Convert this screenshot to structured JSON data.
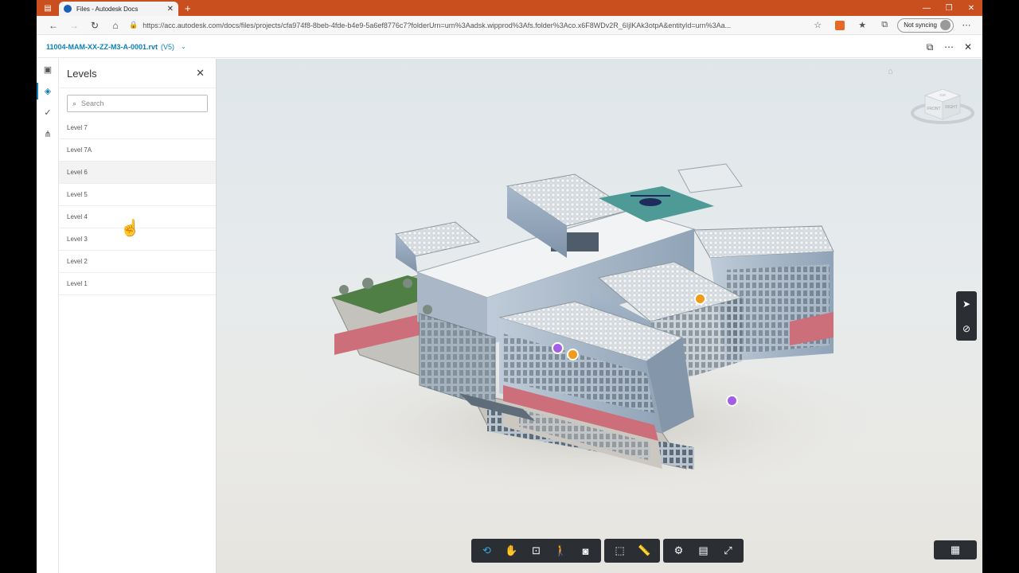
{
  "browser": {
    "tab_title": "Files - Autodesk Docs",
    "tab_close": "✕",
    "new_tab": "+",
    "url": "https://acc.autodesk.com/docs/files/projects/cfa974f8-8beb-4fde-b4e9-5a6ef8776c7?folderUrn=urn%3Aadsk.wipprod%3Afs.folder%3Aco.x6F8WDv2R_6IjlKAk3otpA&entityId=urn%3Aa...",
    "sync_label": "Not syncing",
    "icons": {
      "back": "←",
      "forward": "→",
      "refresh": "↻",
      "home": "⌂",
      "lock": "🔒",
      "star": "☆",
      "favorites": "★",
      "collections": "⧉",
      "more": "⋯",
      "minimize": "—",
      "restore": "❐",
      "close": "✕"
    }
  },
  "app": {
    "file_name": "11004-MAM-XX-ZZ-M3-A-0001.rvt",
    "file_version": "(V5)",
    "file_chevron": "⌄",
    "header_icons": {
      "compare": "⧉",
      "more": "⋯",
      "close": "✕"
    }
  },
  "rail": [
    {
      "name": "rail-sheets-button",
      "icon": "▣",
      "active": false
    },
    {
      "name": "rail-levels-button",
      "icon": "◈",
      "active": true
    },
    {
      "name": "rail-issues-button",
      "icon": "✓",
      "active": false
    },
    {
      "name": "rail-model-tree-button",
      "icon": "⋔",
      "active": false
    }
  ],
  "levels_panel": {
    "title": "Levels",
    "close": "✕",
    "search_placeholder": "Search",
    "search_icon": "⌕",
    "levels": [
      "Level 7",
      "Level 7A",
      "Level 6",
      "Level 5",
      "Level 4",
      "Level 3",
      "Level 2",
      "Level 1"
    ],
    "hovered_level": "Level 6"
  },
  "viewer": {
    "home_icon": "⌂",
    "viewcube": {
      "front": "FRONT",
      "right": "RIGHT",
      "top": "TOP"
    },
    "side_tools": {
      "select": "➤",
      "markup": "⊘"
    },
    "toolbar_groups": [
      [
        {
          "name": "orbit-tool-button",
          "icon": "⟲",
          "active": true
        },
        {
          "name": "pan-tool-button",
          "icon": "✋",
          "active": false
        },
        {
          "name": "fit-to-view-button",
          "icon": "⊡",
          "active": false
        },
        {
          "name": "first-person-button",
          "icon": "🚶",
          "active": false
        },
        {
          "name": "camera-button",
          "icon": "◙",
          "active": false
        }
      ],
      [
        {
          "name": "section-analysis-button",
          "icon": "⬚",
          "active": false
        },
        {
          "name": "measure-button",
          "icon": "📏",
          "active": false
        }
      ],
      [
        {
          "name": "settings-button",
          "icon": "⚙",
          "active": false
        },
        {
          "name": "properties-button",
          "icon": "▤",
          "active": false
        },
        {
          "name": "fullscreen-button",
          "icon": "⤢",
          "active": false
        }
      ]
    ],
    "model_browser_icon": "▦",
    "accent_color": "#38a4e6",
    "pin_colors": {
      "issue": "#a35ee6",
      "rfi": "#f09b1b"
    }
  }
}
